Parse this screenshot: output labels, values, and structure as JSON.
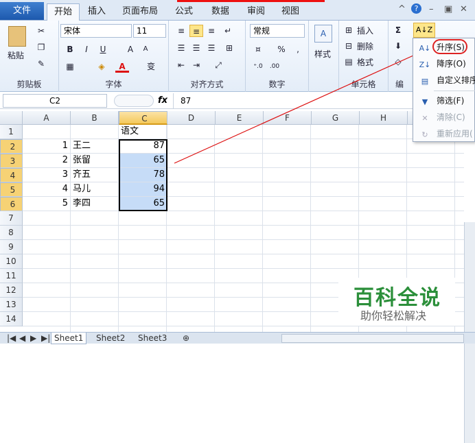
{
  "tabs": [
    {
      "label": "文件"
    },
    {
      "label": "开始"
    },
    {
      "label": "插入"
    },
    {
      "label": "页面布局"
    },
    {
      "label": "公式"
    },
    {
      "label": "数据"
    },
    {
      "label": "审阅"
    },
    {
      "label": "视图"
    }
  ],
  "ribbon": {
    "clipboard": {
      "paste": "粘贴",
      "label": "剪贴板"
    },
    "font": {
      "name": "宋体",
      "size": "11",
      "label": "字体",
      "bold": "B",
      "italic": "I",
      "underline": "U",
      "grow": "A",
      "shrink": "A",
      "wen": "变"
    },
    "alignment": {
      "label": "对齐方式"
    },
    "number": {
      "format": "常规",
      "percent": "%",
      "comma": ",",
      "label": "数字"
    },
    "styles": {
      "label": "样式"
    },
    "cells": {
      "insert": "插入",
      "delete": "删除",
      "format": "格式",
      "label": "单元格"
    },
    "editing": {
      "label": "编",
      "sigma": "Σ"
    }
  },
  "formula_bar": {
    "name_box": "C2",
    "fx": "fx",
    "value": "87"
  },
  "columns": [
    "A",
    "B",
    "C",
    "D",
    "E",
    "F",
    "G",
    "H"
  ],
  "rows": [
    "1",
    "2",
    "3",
    "4",
    "5",
    "6",
    "7",
    "8",
    "9",
    "10",
    "11",
    "12",
    "13",
    "14"
  ],
  "cells": {
    "C1": "语文",
    "A2": "1",
    "B2": "王二",
    "C2": "87",
    "A3": "2",
    "B3": "张留",
    "C3": "65",
    "A4": "3",
    "B4": "齐五",
    "C4": "78",
    "A5": "4",
    "B5": "马儿",
    "C5": "94",
    "A6": "5",
    "B6": "李四",
    "C6": "65"
  },
  "sort_menu": {
    "asc": "升序(S)",
    "desc": "降序(O)",
    "custom": "自定义排序",
    "filter": "筛选(F)",
    "clear": "清除(C)",
    "reapply": "重新应用("
  },
  "sheets": [
    "Sheet1",
    "Sheet2",
    "Sheet3"
  ],
  "watermark": {
    "title": "百科全说",
    "subtitle": "助你轻松解决"
  },
  "colors": {
    "accent": "#2b5faf",
    "selection": "#c6dcf7",
    "highlight": "#fde68a",
    "annotation": "#dd1111"
  }
}
